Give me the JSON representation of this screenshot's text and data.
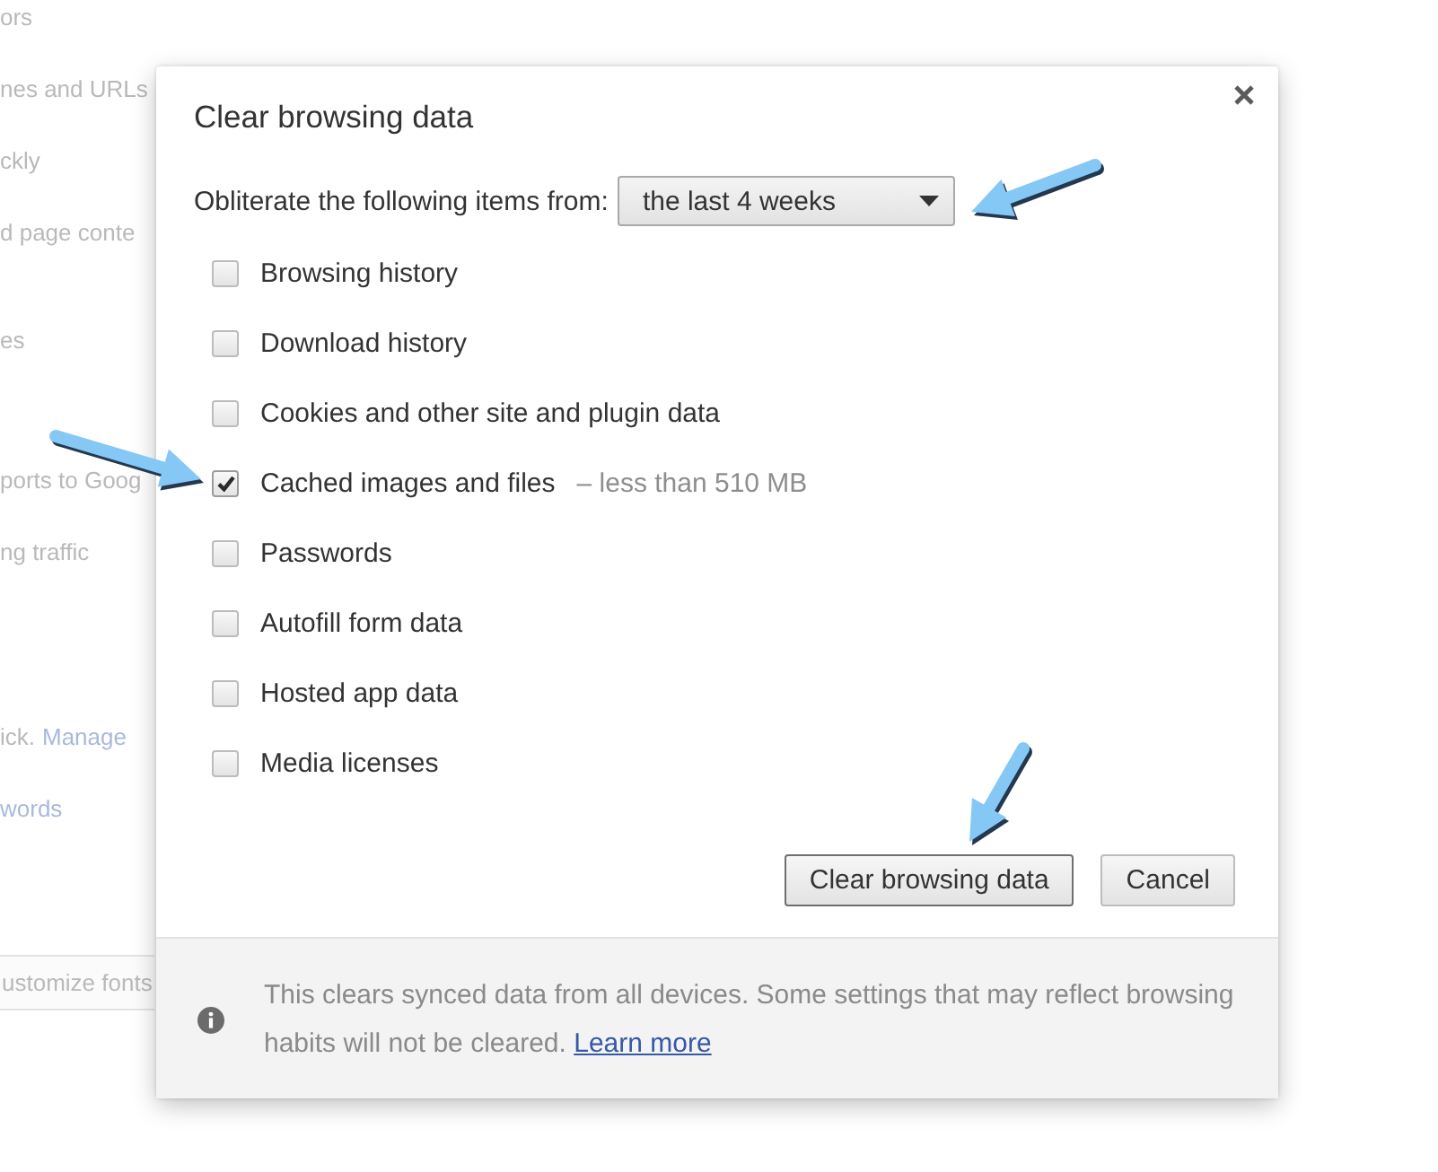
{
  "background_page": {
    "sections": [
      {
        "items": [
          {
            "kind": "text",
            "text": "ors"
          },
          {
            "kind": "text",
            "text": "nes and URLs"
          },
          {
            "kind": "text",
            "text": "ckly"
          },
          {
            "kind": "text",
            "text": "d page conte"
          }
        ]
      },
      {
        "items": [
          {
            "kind": "text",
            "text": "es"
          }
        ]
      },
      {
        "items": [
          {
            "kind": "text",
            "text": "ports to Goog"
          },
          {
            "kind": "text",
            "text": "ng traffic"
          }
        ]
      },
      {
        "items": [
          {
            "kind": "text_link",
            "text": "ick.",
            "link": "Manage"
          },
          {
            "kind": "link",
            "text": "words"
          }
        ]
      },
      {
        "items": [
          {
            "kind": "button",
            "text": "ustomize fonts"
          }
        ]
      }
    ]
  },
  "dialog": {
    "title": "Clear browsing data",
    "range": {
      "label": "Obliterate the following items from:",
      "value": "the last 4 weeks"
    },
    "items": [
      {
        "label": "Browsing history",
        "checked": false
      },
      {
        "label": "Download history",
        "checked": false
      },
      {
        "label": "Cookies and other site and plugin data",
        "checked": false
      },
      {
        "label": "Cached images and files",
        "checked": true,
        "detail": "– less than 510 MB"
      },
      {
        "label": "Passwords",
        "checked": false
      },
      {
        "label": "Autofill form data",
        "checked": false
      },
      {
        "label": "Hosted app data",
        "checked": false
      },
      {
        "label": "Media licenses",
        "checked": false
      }
    ],
    "buttons": [
      {
        "label": "Clear browsing data",
        "focused": true
      },
      {
        "label": "Cancel",
        "focused": false
      }
    ],
    "footer": {
      "text": "This clears synced data from all devices. Some settings that may reflect browsing habits will not be cleared.",
      "link": "Learn more"
    }
  }
}
